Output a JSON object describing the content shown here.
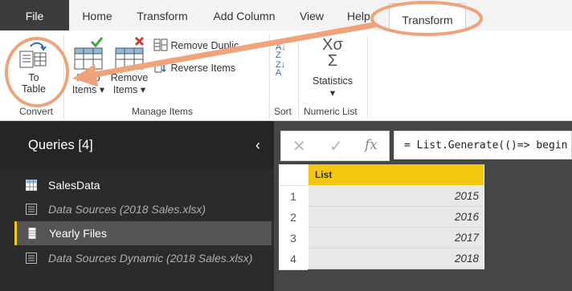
{
  "tabs": {
    "file": "File",
    "home": "Home",
    "transform": "Transform",
    "add_column": "Add Column",
    "view": "View",
    "help": "Help",
    "context_transform": "Transform"
  },
  "ribbon": {
    "convert": {
      "to_table_line1": "To",
      "to_table_line2": "Table",
      "group": "Convert"
    },
    "manage": {
      "keep_line1": "Keep",
      "keep_line2": "Items",
      "remove_line1": "Remove",
      "remove_line2": "Items",
      "remove_duplicates": "Remove Duplic",
      "reverse_items": "Reverse Items",
      "group": "Manage Items"
    },
    "sort": {
      "group": "Sort"
    },
    "numeric": {
      "statistics": "Statistics",
      "group": "Numeric List"
    }
  },
  "queries": {
    "title": "Queries [4]",
    "items": [
      {
        "label": "SalesData"
      },
      {
        "label": "Data Sources (2018 Sales.xlsx)"
      },
      {
        "label": "Yearly Files"
      },
      {
        "label": "Data Sources Dynamic (2018 Sales.xlsx)"
      }
    ]
  },
  "formula": {
    "text": "= List.Generate(()=> begin"
  },
  "table": {
    "column": "List",
    "row_numbers": [
      "1",
      "2",
      "3",
      "4"
    ],
    "values": [
      "2015",
      "2016",
      "2017",
      "2018"
    ]
  },
  "colors": {
    "annotation": "#f0a37a",
    "column_header": "#f2c811",
    "dark_panel": "#2b2b2b",
    "selected_query": "#555555"
  },
  "icons": [
    "table-icon",
    "keep-items-icon",
    "remove-items-icon",
    "remove-duplicates-icon",
    "reverse-items-icon",
    "sort-asc-icon",
    "sort-desc-icon",
    "statistics-icon",
    "cancel-icon",
    "check-icon",
    "fx-icon",
    "collapse-chevron-icon"
  ]
}
